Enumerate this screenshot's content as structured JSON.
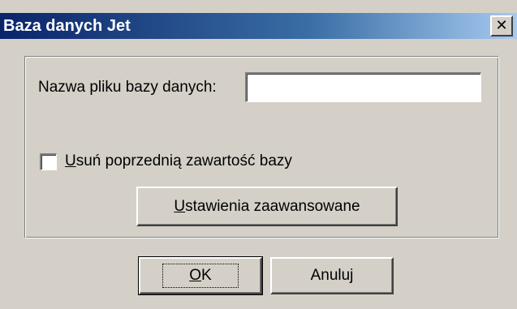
{
  "window": {
    "title": "Baza danych Jet",
    "close_glyph": "✕"
  },
  "form": {
    "filename_label": "Nazwa pliku bazy danych:",
    "filename_value": "",
    "checkbox_label_mnemonic": "U",
    "checkbox_label_rest": "suń poprzednią zawartość bazy",
    "checkbox_checked": false,
    "advanced_mnemonic": "U",
    "advanced_rest": "stawienia zaawansowane"
  },
  "buttons": {
    "ok_mnemonic": "O",
    "ok_rest": "K",
    "cancel_label": "Anuluj"
  },
  "colors": {
    "dialog_bg": "#d4d0c8",
    "title_start": "#0a246a",
    "title_end": "#a6caf0"
  },
  "icons": {
    "close": "close-icon"
  }
}
